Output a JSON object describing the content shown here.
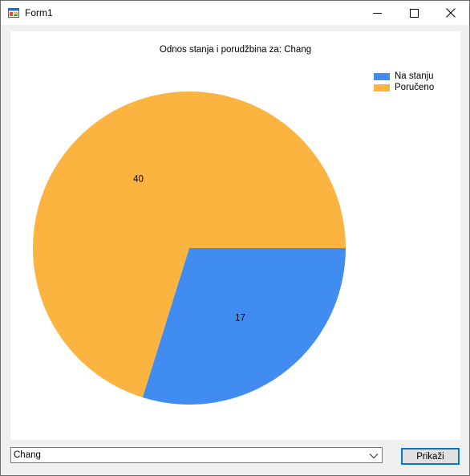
{
  "window": {
    "title": "Form1"
  },
  "chart_data": {
    "type": "pie",
    "title": "Odnos stanja i porudžbina za: Chang",
    "legend_position": "top-right",
    "slices": [
      {
        "label": "Na stanju",
        "value": 17,
        "color": "#418cf0"
      },
      {
        "label": "Poručeno",
        "value": 40,
        "color": "#fcb441"
      }
    ]
  },
  "controls": {
    "product_select": {
      "value": "Chang"
    },
    "show_button": {
      "label": "Prikaži"
    }
  },
  "icons": {
    "app": "form-app-icon",
    "minimize": "minimize-icon",
    "maximize": "maximize-icon",
    "close": "close-icon",
    "dropdown": "chevron-down-icon"
  }
}
